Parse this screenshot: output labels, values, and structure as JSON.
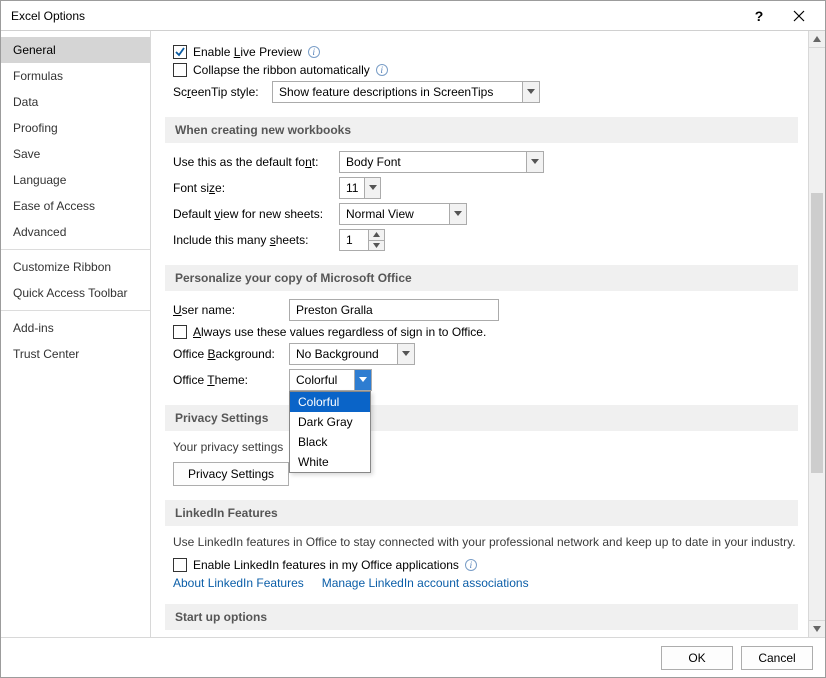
{
  "title": "Excel Options",
  "sidebar": {
    "items": [
      {
        "label": "General",
        "selected": true
      },
      {
        "label": "Formulas"
      },
      {
        "label": "Data"
      },
      {
        "label": "Proofing"
      },
      {
        "label": "Save"
      },
      {
        "label": "Language"
      },
      {
        "label": "Ease of Access"
      },
      {
        "label": "Advanced"
      },
      {
        "sep": true
      },
      {
        "label": "Customize Ribbon"
      },
      {
        "label": "Quick Access Toolbar"
      },
      {
        "sep": true
      },
      {
        "label": "Add-ins"
      },
      {
        "label": "Trust Center"
      }
    ]
  },
  "top": {
    "enable_live_preview": "Enable Live Preview",
    "collapse_ribbon": "Collapse the ribbon automatically",
    "screentip_label": "ScreenTip style:",
    "screentip_value": "Show feature descriptions in ScreenTips"
  },
  "newwb": {
    "heading": "When creating new workbooks",
    "font_label": "Use this as the default font:",
    "font_value": "Body Font",
    "size_label": "Font size:",
    "size_value": "11",
    "view_label": "Default view for new sheets:",
    "view_value": "Normal View",
    "sheets_label": "Include this many sheets:",
    "sheets_value": "1"
  },
  "personalize": {
    "heading": "Personalize your copy of Microsoft Office",
    "user_label": "User name:",
    "user_value": "Preston Gralla",
    "always_use": "Always use these values regardless of sign in to Office.",
    "bg_label": "Office Background:",
    "bg_value": "No Background",
    "theme_label": "Office Theme:",
    "theme_value": "Colorful",
    "theme_options": [
      "Colorful",
      "Dark Gray",
      "Black",
      "White"
    ]
  },
  "privacy": {
    "heading": "Privacy Settings",
    "intro": "Your privacy settings",
    "button": "Privacy Settings"
  },
  "linkedin": {
    "heading": "LinkedIn Features",
    "desc": "Use LinkedIn features in Office to stay connected with your professional network and keep up to date in your industry.",
    "enable": "Enable LinkedIn features in my Office applications",
    "about": "About LinkedIn Features",
    "manage": "Manage LinkedIn account associations"
  },
  "startup": {
    "heading": "Start up options"
  },
  "footer": {
    "ok": "OK",
    "cancel": "Cancel"
  }
}
